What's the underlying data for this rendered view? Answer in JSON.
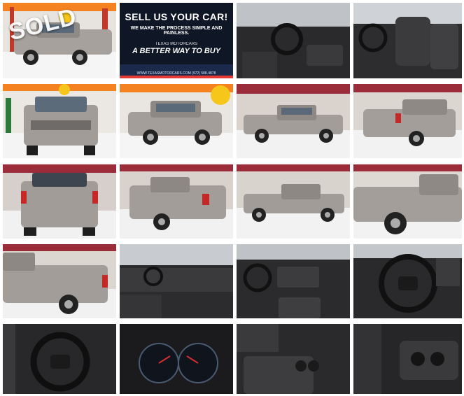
{
  "gallery": {
    "sold_label": "SOLD",
    "ad": {
      "headline": "SELL US YOUR CAR!",
      "subline": "WE MAKE THE PROCESS SIMPLE AND PAINLESS.",
      "brand": "TEXAS MOTORCARS",
      "tagline": "A BETTER WAY TO BUY",
      "footer": "WWW.TEXASMOTORCARS.COM    (972) 588-4878"
    },
    "colors": {
      "truck": "#9a9591",
      "showroom_wall": "#e9eaec",
      "floor": "#f3f3f3",
      "interior": "#2b2b2d",
      "ad_bg": "#101828",
      "ad_accent": "#e53935"
    }
  }
}
